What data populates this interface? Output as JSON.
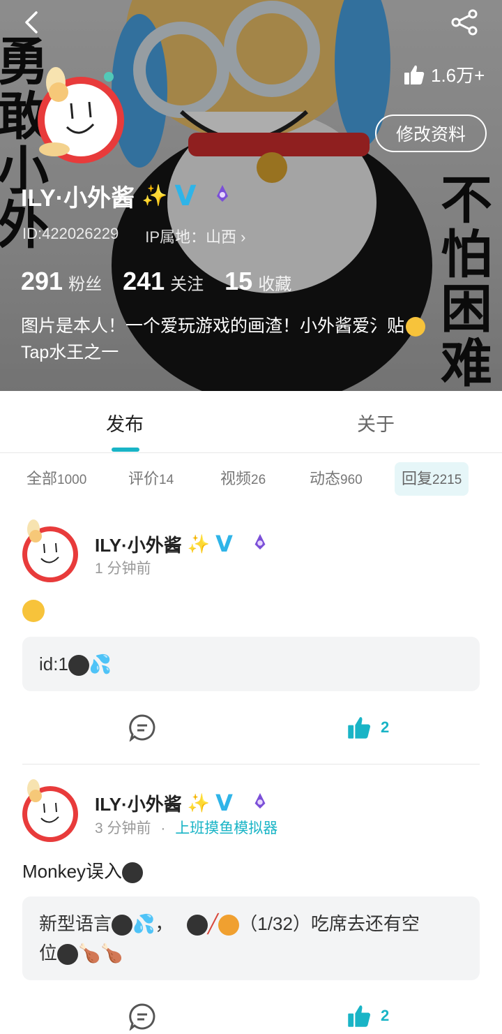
{
  "header": {
    "background_text_left": [
      "勇",
      "敢",
      "小",
      "外"
    ],
    "background_text_right": [
      "不",
      "怕",
      "困",
      "难"
    ],
    "likes_count": "1.6万+",
    "edit_profile_label": "修改资料",
    "username": "ILY·小外酱",
    "user_id": "ID:422026229",
    "ip_location": "IP属地：山西",
    "stats": [
      {
        "value": "291",
        "label": "粉丝"
      },
      {
        "value": "241",
        "label": "关注"
      },
      {
        "value": "15",
        "label": "收藏"
      }
    ],
    "bio_line1": "图片是本人！一个爱玩游戏的画渣！小外酱爱氵贴",
    "bio_line2": "Tap水王之一"
  },
  "tabs": [
    {
      "label": "发布",
      "active": true
    },
    {
      "label": "关于",
      "active": false
    }
  ],
  "filters": [
    {
      "label": "全部",
      "count": "1000",
      "active": false
    },
    {
      "label": "评价",
      "count": "14",
      "active": false
    },
    {
      "label": "视频",
      "count": "26",
      "active": false
    },
    {
      "label": "动态",
      "count": "960",
      "active": false
    },
    {
      "label": "回复",
      "count": "2215",
      "active": true
    }
  ],
  "posts": [
    {
      "author": "ILY·小外酱",
      "time": "1 分钟前",
      "game": "",
      "text": "",
      "quote": "id:1",
      "likes": "2"
    },
    {
      "author": "ILY·小外酱",
      "time": "3 分钟前",
      "separator": "·",
      "game": "上班摸鱼模拟器",
      "text": "Monkey误入",
      "quote_line1_a": "新型语言",
      "quote_line1_b": "，",
      "quote_line1_c": "（1/32）吃席去还有空",
      "quote_line2": "位",
      "likes": "2"
    }
  ],
  "colors": {
    "accent": "#19b4c6",
    "verified": "#2fb4e8",
    "filter_active_bg": "#e6f6f8"
  }
}
